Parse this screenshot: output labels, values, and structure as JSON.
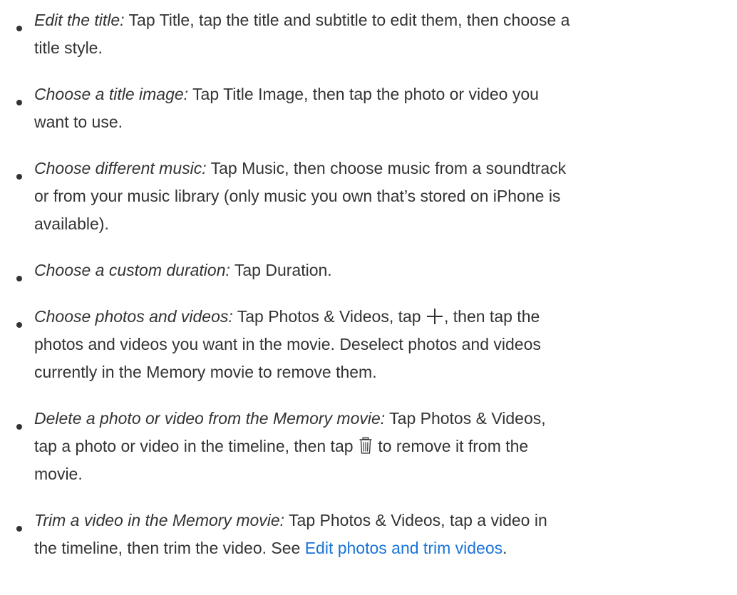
{
  "items": [
    {
      "lead": "Edit the title:",
      "l1": " Tap Title, tap the title and subtitle to edit them, then choose a",
      "l2": "title style."
    },
    {
      "lead": "Choose a title image:",
      "l1": " Tap Title Image, then tap the photo or video you",
      "l2": "want to use."
    },
    {
      "lead": "Choose different music:",
      "l1": " Tap Music, then choose music from a soundtrack",
      "l2": "or from your music library (only music you own that’s stored on iPhone is",
      "l3": "available)."
    },
    {
      "lead": "Choose a custom duration:",
      "l1": " Tap Duration."
    },
    {
      "lead": "Choose photos and videos:",
      "l1a": " Tap Photos & Videos, tap",
      "icon": "plus-icon",
      "l1b": ", then tap the",
      "l2": "photos and videos you want in the movie. Deselect photos and videos",
      "l3": "currently in the Memory movie to remove them."
    },
    {
      "lead": "Delete a photo or video from the Memory movie:",
      "l1": " Tap Photos & Videos,",
      "l2a": "tap a photo or video in the timeline, then tap",
      "icon": "trash-icon",
      "l2b": "to remove it from the",
      "l3": "movie."
    },
    {
      "lead": "Trim a video in the Memory movie:",
      "l1": " Tap Photos & Videos, tap a video in",
      "l2a": "the timeline, then trim the video. See ",
      "link": "Edit photos and trim videos",
      "l2b": "."
    }
  ],
  "colors": {
    "text": "#333333",
    "link": "#1a73d8",
    "background": "#ffffff"
  }
}
